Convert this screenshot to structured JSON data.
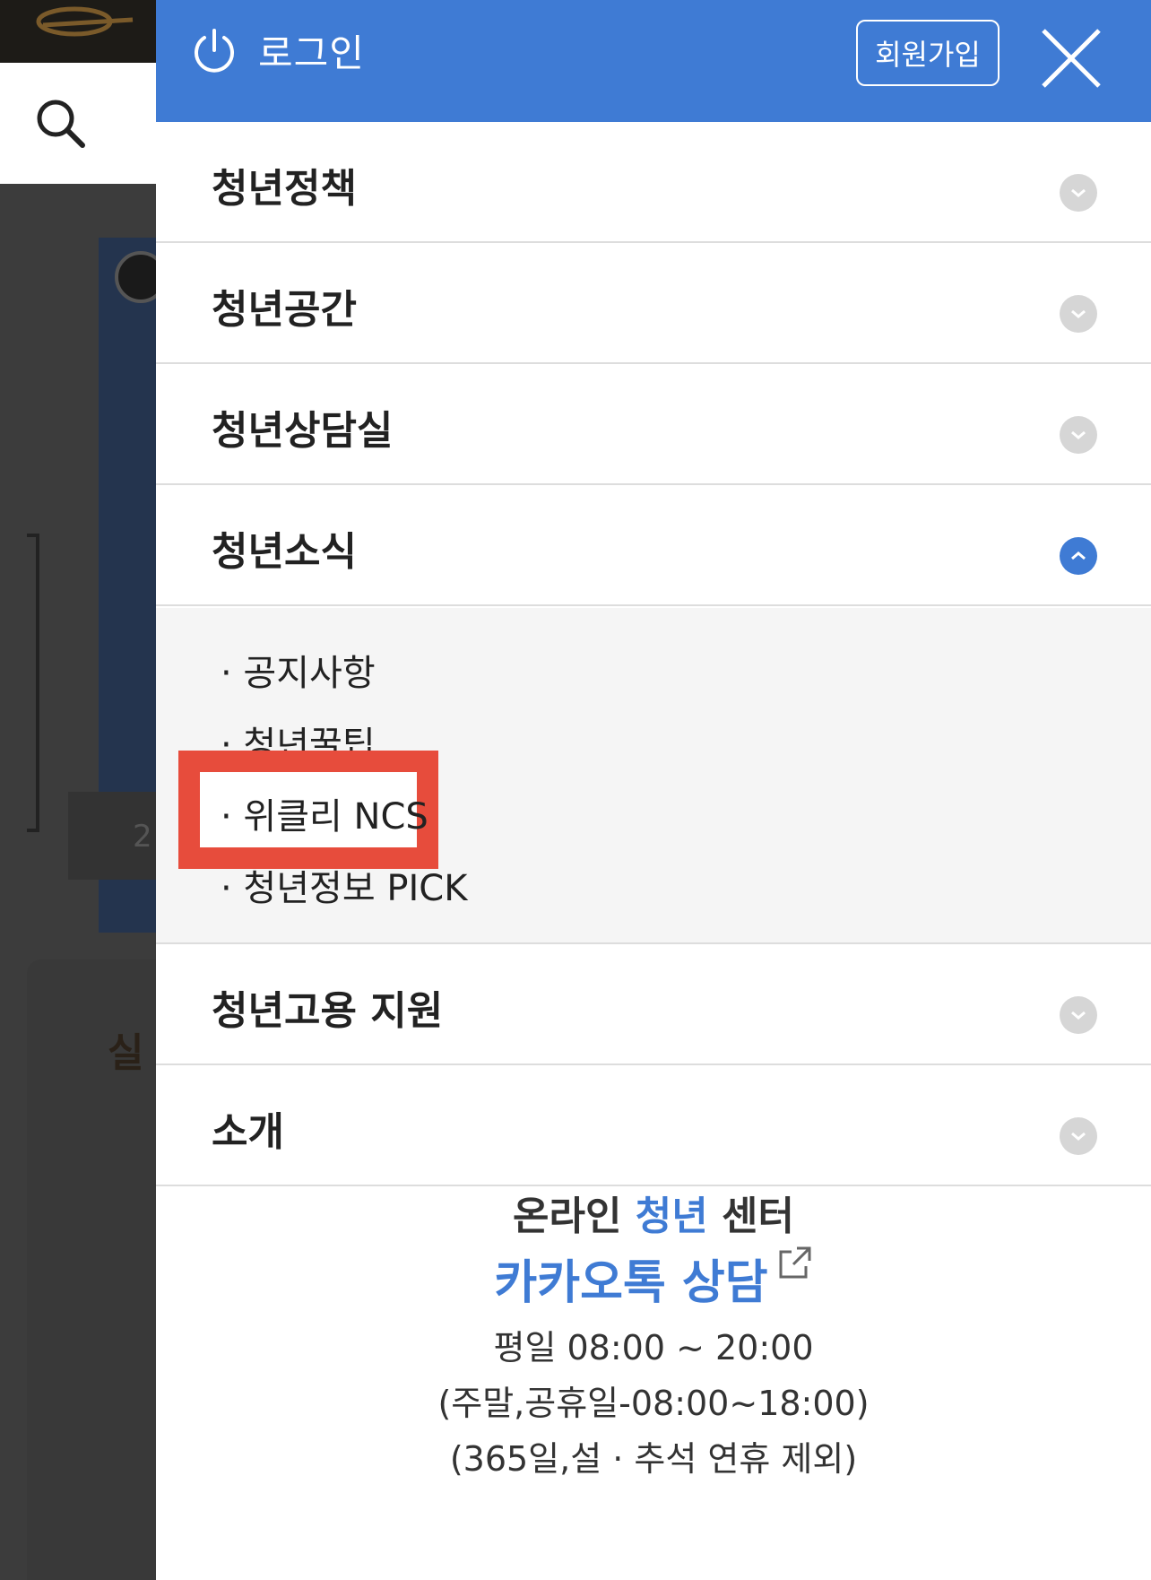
{
  "header": {
    "login_label": "로그인",
    "signup_label": "회원가입",
    "accent_color": "#3f7bd4"
  },
  "menu": [
    {
      "label": "청년정책",
      "expanded": false
    },
    {
      "label": "청년공간",
      "expanded": false
    },
    {
      "label": "청년상담실",
      "expanded": false
    },
    {
      "label": "청년소식",
      "expanded": true,
      "children": [
        "· 공지사항",
        "· 청년꿀팁",
        "· 위클리 NCS",
        "· 청년정보 PICK"
      ]
    },
    {
      "label": "청년고용 지원",
      "expanded": false
    },
    {
      "label": "소개",
      "expanded": false
    }
  ],
  "highlighted_item": "· 위클리 NCS",
  "footer": {
    "title_prefix": "온라인 ",
    "title_accent": "청년",
    "title_suffix": " 센터",
    "kakao_label": "카카오톡 상담",
    "hours_weekday": "평일 08:00 ~ 20:00",
    "hours_weekend": "(주말,공휴일-08:00~18:00)",
    "hours_note": "(365일,설 · 추석 연휴 제외)"
  },
  "background": {
    "card_title_partial": "실",
    "chip_text": "2"
  },
  "icons": {
    "power": "power-icon",
    "close": "close-icon",
    "search": "search-icon",
    "chevron_down": "chevron-down-icon",
    "chevron_up": "chevron-up-icon",
    "external": "external-link-icon"
  }
}
